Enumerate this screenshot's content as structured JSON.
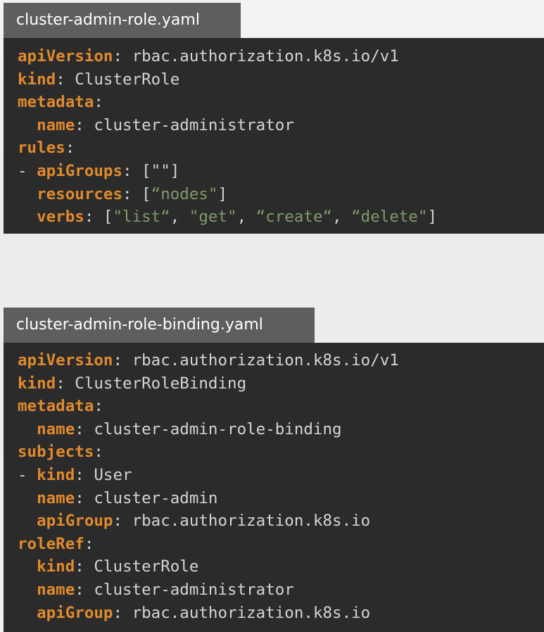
{
  "file1": {
    "tab_label": "cluster-admin-role.yaml",
    "lines": [
      {
        "indent": "",
        "dash": "",
        "key": "apiVersion",
        "sep": ": ",
        "value": "rbac.authorization.k8s.io/v1",
        "value_type": "plain"
      },
      {
        "indent": "",
        "dash": "",
        "key": "kind",
        "sep": ": ",
        "value": "ClusterRole",
        "value_type": "plain"
      },
      {
        "indent": "",
        "dash": "",
        "key": "metadata",
        "sep": ":",
        "value": "",
        "value_type": "plain"
      },
      {
        "indent": "  ",
        "dash": "",
        "key": "name",
        "sep": ": ",
        "value": "cluster-administrator",
        "value_type": "plain"
      },
      {
        "indent": "",
        "dash": "",
        "key": "rules",
        "sep": ":",
        "value": "",
        "value_type": "plain"
      },
      {
        "indent": "",
        "dash": "- ",
        "key": "apiGroups",
        "sep": ": ",
        "value": "[\"\"]",
        "value_type": "plain"
      },
      {
        "indent": "  ",
        "dash": "",
        "key": "resources",
        "sep": ": ",
        "value": "",
        "value_type": "array",
        "array": {
          "open": "[",
          "close": "]",
          "items": [
            "“nodes\""
          ]
        }
      },
      {
        "indent": "  ",
        "dash": "",
        "key": "verbs",
        "sep": ": ",
        "value": "",
        "value_type": "array",
        "array": {
          "open": "[",
          "close": "]",
          "items": [
            "\"list“",
            "\"get\"",
            "“create“",
            "“delete\""
          ]
        }
      }
    ]
  },
  "file2": {
    "tab_label": "cluster-admin-role-binding.yaml",
    "lines": [
      {
        "indent": "",
        "dash": "",
        "key": "apiVersion",
        "sep": ": ",
        "value": "rbac.authorization.k8s.io/v1",
        "value_type": "plain"
      },
      {
        "indent": "",
        "dash": "",
        "key": "kind",
        "sep": ": ",
        "value": "ClusterRoleBinding",
        "value_type": "plain"
      },
      {
        "indent": "",
        "dash": "",
        "key": "metadata",
        "sep": ":",
        "value": "",
        "value_type": "plain"
      },
      {
        "indent": "  ",
        "dash": "",
        "key": "name",
        "sep": ": ",
        "value": "cluster-admin-role-binding",
        "value_type": "plain"
      },
      {
        "indent": "",
        "dash": "",
        "key": "subjects",
        "sep": ":",
        "value": "",
        "value_type": "plain"
      },
      {
        "indent": "",
        "dash": "- ",
        "key": "kind",
        "sep": ": ",
        "value": "User",
        "value_type": "plain"
      },
      {
        "indent": "  ",
        "dash": "",
        "key": "name",
        "sep": ": ",
        "value": "cluster-admin",
        "value_type": "plain"
      },
      {
        "indent": "  ",
        "dash": "",
        "key": "apiGroup",
        "sep": ": ",
        "value": "rbac.authorization.k8s.io",
        "value_type": "plain"
      },
      {
        "indent": "",
        "dash": "",
        "key": "roleRef",
        "sep": ":",
        "value": "",
        "value_type": "plain"
      },
      {
        "indent": "  ",
        "dash": "",
        "key": "kind",
        "sep": ": ",
        "value": "ClusterRole",
        "value_type": "plain"
      },
      {
        "indent": "  ",
        "dash": "",
        "key": "name",
        "sep": ": ",
        "value": "cluster-administrator",
        "value_type": "plain"
      },
      {
        "indent": "  ",
        "dash": "",
        "key": "apiGroup",
        "sep": ": ",
        "value": "rbac.authorization.k8s.io",
        "value_type": "plain"
      }
    ]
  },
  "colors": {
    "key": "#e08a2c",
    "string": "#7f9a6a",
    "plain": "#d4d4d4",
    "panel_background": "#2b2b2b",
    "tab_background": "#5e5e5e"
  }
}
